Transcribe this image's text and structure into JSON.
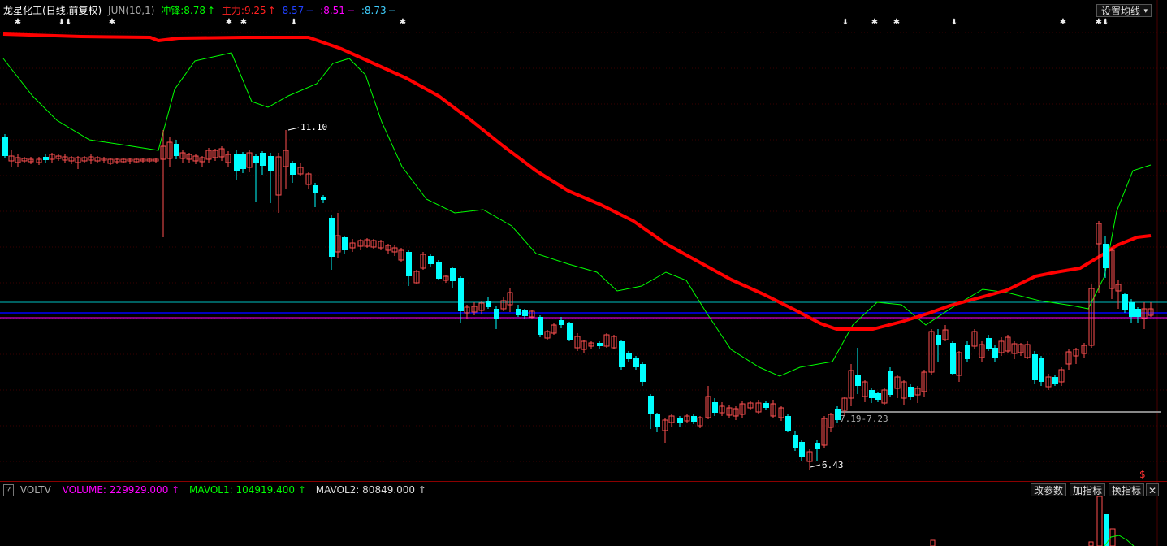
{
  "header": {
    "stock_name": "龙星化工",
    "period": "(日线,前复权)",
    "indicator": "JUN(10,1)",
    "chongfeng_label": "冲锋:",
    "chongfeng_value": "8.78",
    "chongfeng_arrow": "↑",
    "zhuli_label": "主力:",
    "zhuli_value": "9.25",
    "zhuli_arrow": "↑",
    "v3_value": "8.57",
    "v3_arrow": "−",
    "v4_label": ":",
    "v4_value": "8.51",
    "v4_arrow": "−",
    "v5_label": ":",
    "v5_value": "8.73",
    "v5_arrow": "−",
    "ma_button": "设置均线",
    "ma_button_arrow": "▾"
  },
  "annotations": {
    "high_label": "11.10",
    "low_label": "6.43",
    "range_label": "7.19-7.23",
    "dollar_marker": "$"
  },
  "volume_panel": {
    "help_icon": "?",
    "name": "VOLTV",
    "volume_label": "VOLUME:",
    "volume_value": "229929.000",
    "volume_arrow": "↑",
    "mavol1_label": "MAVOL1:",
    "mavol1_value": "104919.400",
    "mavol1_arrow": "↑",
    "mavol2_label": "MAVOL2:",
    "mavol2_value": "80849.000",
    "mavol2_arrow": "↑",
    "btn_change_params": "改参数",
    "btn_add_indicator": "加指标",
    "btn_switch_indicator": "换指标",
    "btn_close": "✕"
  },
  "colors": {
    "up": "#ff5050",
    "down": "#00ffff",
    "red_ma": "#ff0000",
    "green_line": "#00ff00",
    "purple": "#ff00ff",
    "blue": "#0000ff",
    "cyan_line": "#00c0c0"
  }
}
